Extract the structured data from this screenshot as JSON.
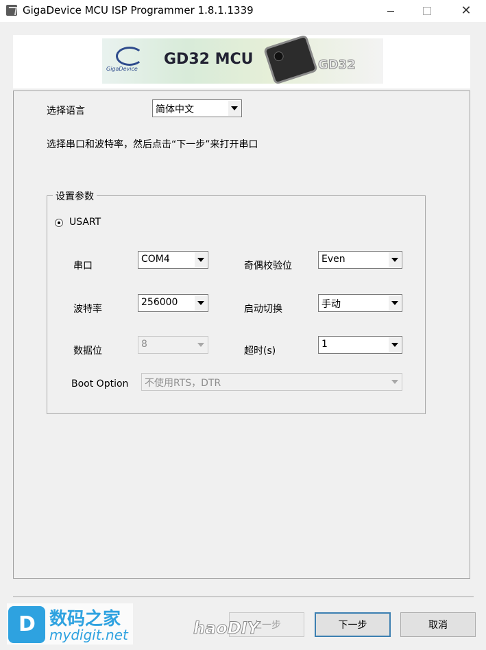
{
  "window": {
    "title": "GigaDevice MCU ISP Programmer 1.8.1.1339",
    "minimize_glyph": "—",
    "close_glyph": "✕"
  },
  "banner": {
    "logo_text": "GigaDevice",
    "product_title": "GD32 MCU",
    "chip_text": "GD32"
  },
  "language": {
    "label": "选择语言",
    "value": "简体中文"
  },
  "instruction": "选择串口和波特率，然后点击“下一步”来打开串口",
  "settings": {
    "group_title": "设置参数",
    "mode_label": "USART",
    "port_label": "串口",
    "port_value": "COM4",
    "parity_label": "奇偶校验位",
    "parity_value": "Even",
    "baud_label": "波特率",
    "baud_value": "256000",
    "boot_switch_label": "启动切换",
    "boot_switch_value": "手动",
    "databits_label": "数据位",
    "databits_value": "8",
    "timeout_label": "超时(s)",
    "timeout_value": "1",
    "boot_option_label": "Boot Option",
    "boot_option_value": "不使用RTS，DTR"
  },
  "buttons": {
    "prev_label": "上一步",
    "next_label": "下一步",
    "cancel_label": "取消"
  },
  "watermarks": {
    "site_cn": "数码之家",
    "site_en": "mydigit.net",
    "site2": "haoDIY"
  }
}
